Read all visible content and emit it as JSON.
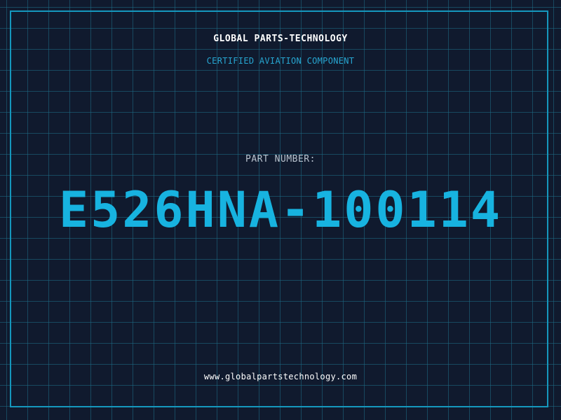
{
  "header": {
    "company_name": "GLOBAL PARTS-TECHNOLOGY",
    "tagline": "CERTIFIED AVIATION COMPONENT"
  },
  "part": {
    "label": "PART NUMBER:",
    "number": "E526HNA-100114"
  },
  "footer": {
    "website": "www.globalpartstechnology.com"
  },
  "colors": {
    "background": "#101a2e",
    "grid": "#1e6e87",
    "accent": "#17b3e0",
    "border": "#1597bd",
    "label": "#b9c3cf",
    "text": "#ffffff"
  }
}
